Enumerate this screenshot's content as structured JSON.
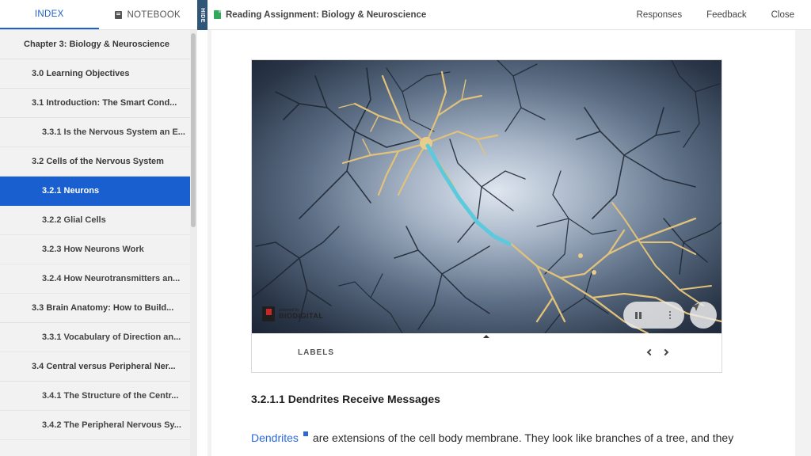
{
  "sidebar": {
    "tabs": [
      {
        "label": "INDEX",
        "active": true
      },
      {
        "label": "NOTEBOOK",
        "active": false
      }
    ],
    "toc": [
      {
        "label": "Chapter 3: Biology & Neuroscience",
        "level": 0
      },
      {
        "label": "3.0 Learning Objectives",
        "level": 1
      },
      {
        "label": "3.1 Introduction: The Smart Cond...",
        "level": 1
      },
      {
        "label": "3.3.1 Is the Nervous System an E...",
        "level": 2
      },
      {
        "label": "3.2 Cells of the Nervous System",
        "level": 1
      },
      {
        "label": "3.2.1 Neurons",
        "level": 2,
        "active": true
      },
      {
        "label": "3.2.2 Glial Cells",
        "level": 2
      },
      {
        "label": "3.2.3 How Neurons Work",
        "level": 2
      },
      {
        "label": "3.2.4 How Neurotransmitters an...",
        "level": 2
      },
      {
        "label": "3.3 Brain Anatomy: How to Build...",
        "level": 1
      },
      {
        "label": "3.3.1 Vocabulary of Direction an...",
        "level": 2
      },
      {
        "label": "3.4 Central versus Peripheral Ner...",
        "level": 1
      },
      {
        "label": "3.4.1 The Structure of the Centr...",
        "level": 2
      },
      {
        "label": "3.4.2 The Peripheral Nervous Sy...",
        "level": 2
      }
    ],
    "hide_label": "HIDE"
  },
  "header": {
    "title": "Reading Assignment: Biology & Neuroscience",
    "actions": [
      "Responses",
      "Feedback",
      "Close"
    ]
  },
  "viewer": {
    "brand_small": "powered by",
    "brand_name": "BIODIGITAL",
    "labels_text": "LABELS"
  },
  "content": {
    "section_heading": "3.2.1.1 Dendrites Receive Messages",
    "term": "Dendrites",
    "paragraph_rest": "are extensions of the cell body membrane. They look like branches of a tree, and they"
  },
  "colors": {
    "accent": "#1a5fd0",
    "link": "#2a6ad8",
    "doc_icon": "#2faa5a",
    "hide_tab": "#2f5577"
  }
}
